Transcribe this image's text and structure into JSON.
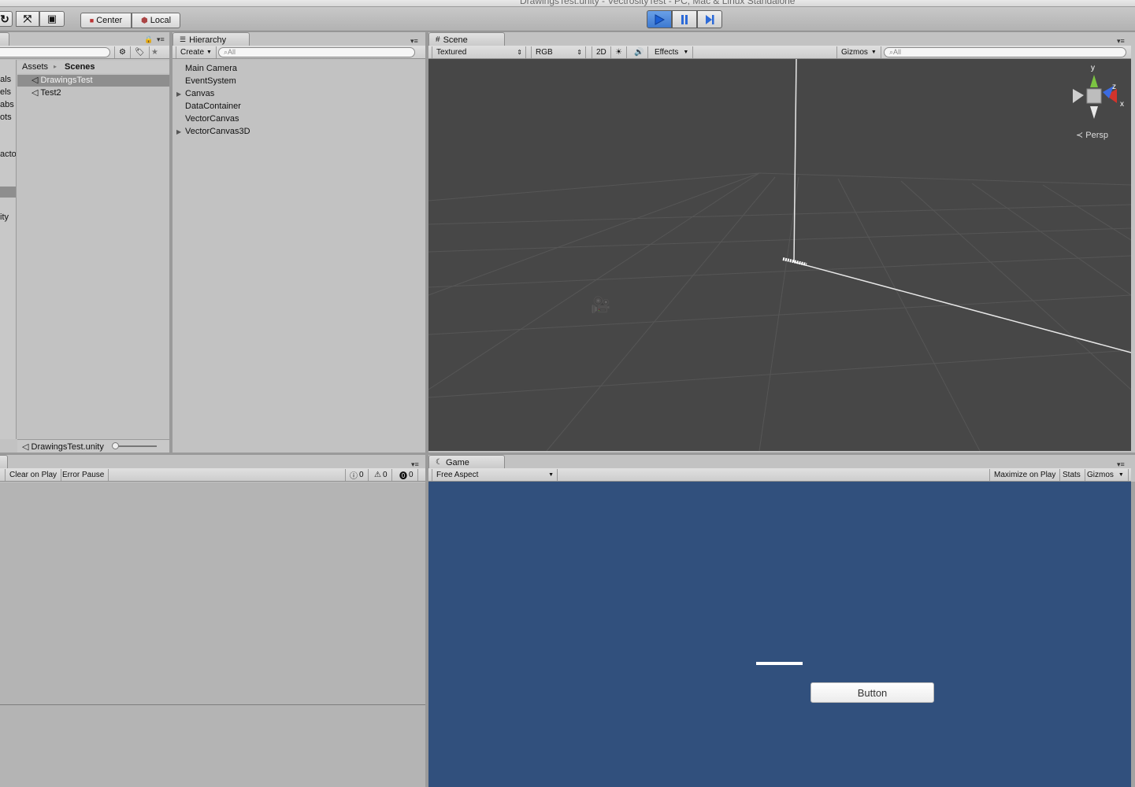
{
  "window": {
    "title": "DrawingsTest.unity - VectrosityTest - PC, Mac & Linux Standalone"
  },
  "toolbar": {
    "pivot_label": "Center",
    "space_label": "Local"
  },
  "project": {
    "breadcrumb_root": "Assets",
    "breadcrumb_current": "Scenes",
    "left_folders": [
      "rials",
      "els",
      "abs",
      "ots",
      "acto",
      "ity"
    ],
    "items": [
      "DrawingsTest",
      "Test2"
    ],
    "footer_path": "DrawingsTest.unity"
  },
  "hierarchy": {
    "tab_label": "Hierarchy",
    "create_label": "Create",
    "search_placeholder": "All",
    "items": [
      "Main Camera",
      "EventSystem",
      "Canvas",
      "DataContainer",
      "VectorCanvas",
      "VectorCanvas3D"
    ]
  },
  "scene": {
    "tab_label": "Scene",
    "render_mode": "Textured",
    "channel": "RGB",
    "mode_2d": "2D",
    "effects_label": "Effects",
    "gizmos_label": "Gizmos",
    "search_placeholder": "All",
    "persp_label": "Persp",
    "axis_y": "y",
    "axis_z": "z",
    "axis_x": "x"
  },
  "console": {
    "clear_on_play": "Clear on Play",
    "error_pause": "Error Pause",
    "log_count": "0",
    "warning_count": "0",
    "error_count": "0"
  },
  "game": {
    "tab_label": "Game",
    "aspect": "Free Aspect",
    "maximize_label": "Maximize on Play",
    "stats_label": "Stats",
    "gizmos_label": "Gizmos",
    "button_label": "Button"
  },
  "colors": {
    "scene_bg": "#474747",
    "game_bg": "#31507d",
    "play_active": "#3d79d0"
  }
}
